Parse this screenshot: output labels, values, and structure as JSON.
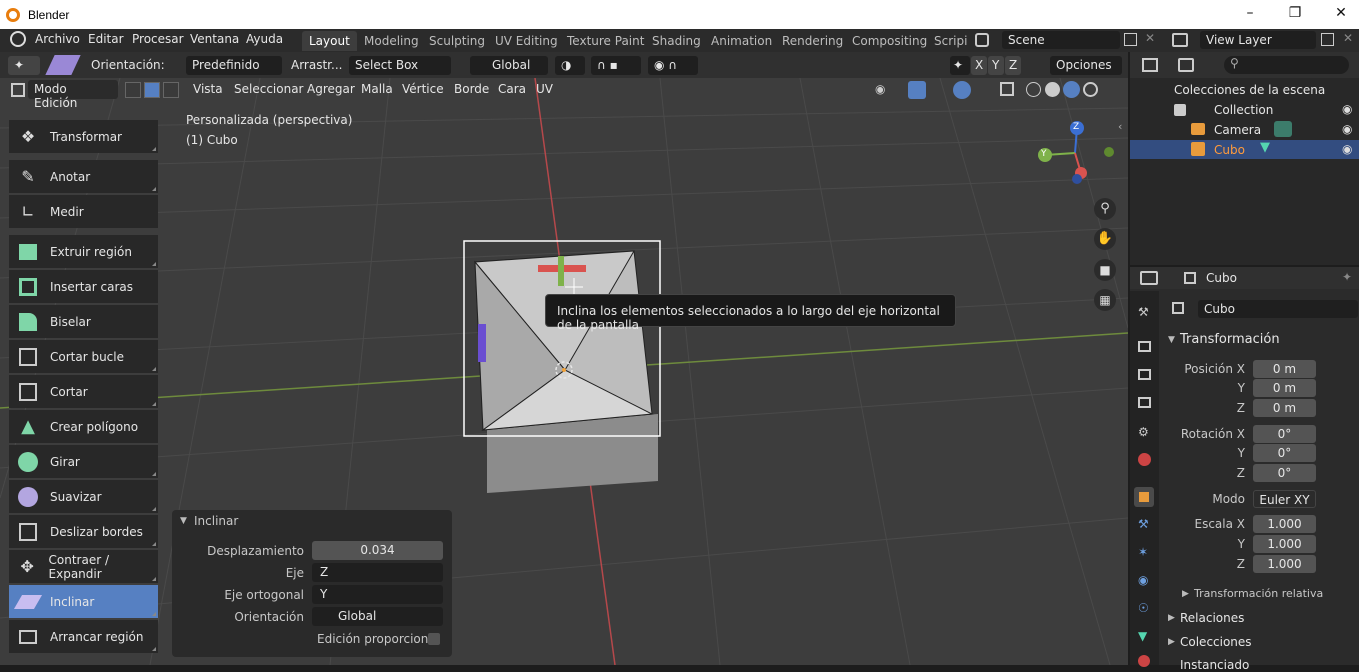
{
  "window": {
    "title": "Blender"
  },
  "menu": [
    "Archivo",
    "Editar",
    "Procesar",
    "Ventana",
    "Ayuda"
  ],
  "workspaces": [
    "Layout",
    "Modeling",
    "Sculpting",
    "UV Editing",
    "Texture Paint",
    "Shading",
    "Animation",
    "Rendering",
    "Compositing",
    "Scripi"
  ],
  "scene": {
    "name": "Scene",
    "view_layer": "View Layer"
  },
  "viewport_header": {
    "orientation_label": "Orientación:",
    "orientation_value": "Predefinido",
    "drag_label": "Arrastr...",
    "select_mode": "Select Box",
    "transform_orientation": "Global",
    "options": "Opciones",
    "axes": [
      "X",
      "Y",
      "Z"
    ]
  },
  "viewport_menu": {
    "mode": "Modo Edición",
    "items": [
      "Vista",
      "Seleccionar",
      "Agregar",
      "Malla",
      "Vértice",
      "Borde",
      "Cara",
      "UV"
    ]
  },
  "viewport_info": {
    "view": "Personalizada (perspectiva)",
    "object": "(1) Cubo"
  },
  "gizmo_axes": [
    "Z",
    "Y"
  ],
  "tools": [
    {
      "label": "Transformar"
    },
    {
      "label": "Anotar"
    },
    {
      "label": "Medir"
    },
    {
      "label": "Extruir región"
    },
    {
      "label": "Insertar caras"
    },
    {
      "label": "Biselar"
    },
    {
      "label": "Cortar bucle"
    },
    {
      "label": "Cortar"
    },
    {
      "label": "Crear polígono"
    },
    {
      "label": "Girar"
    },
    {
      "label": "Suavizar"
    },
    {
      "label": "Deslizar bordes"
    },
    {
      "label": "Contraer / Expandir"
    },
    {
      "label": "Inclinar",
      "active": true
    },
    {
      "label": "Arrancar región"
    }
  ],
  "tooltip": "Inclina los elementos seleccionados a lo largo del eje horizontal de la pantalla",
  "operator_panel": {
    "title": "Inclinar",
    "desplazamiento_label": "Desplazamiento",
    "desplazamiento": "0.034",
    "eje_label": "Eje",
    "eje": "Z",
    "eje_ortogonal_label": "Eje ortogonal",
    "eje_ortogonal": "Y",
    "orientacion_label": "Orientación",
    "orientacion": "Global",
    "edicion_label": "Edición proporcional"
  },
  "outliner": {
    "root": "Colecciones de la escena",
    "collection": "Collection",
    "items": [
      "Camera",
      "Cubo"
    ]
  },
  "properties": {
    "object_name": "Cubo",
    "data_name": "Cubo",
    "section": "Transformación",
    "position_label": "Posición X",
    "position": [
      "0 m",
      "0 m",
      "0 m"
    ],
    "rotation_label": "Rotación X",
    "rotation": [
      "0°",
      "0°",
      "0°"
    ],
    "mode_label": "Modo",
    "mode": "Euler XY",
    "scale_label": "Escala X",
    "scale": [
      "1.000",
      "1.000",
      "1.000"
    ],
    "axis_y": "Y",
    "axis_z": "Z",
    "relative": "Transformación relativa",
    "relations": "Relaciones",
    "collections": "Colecciones",
    "instancing": "Instanciado"
  },
  "colors": {
    "accent": "#5680c2",
    "selected_text": "#ff9b3c",
    "bg": "#3d3d3d"
  }
}
